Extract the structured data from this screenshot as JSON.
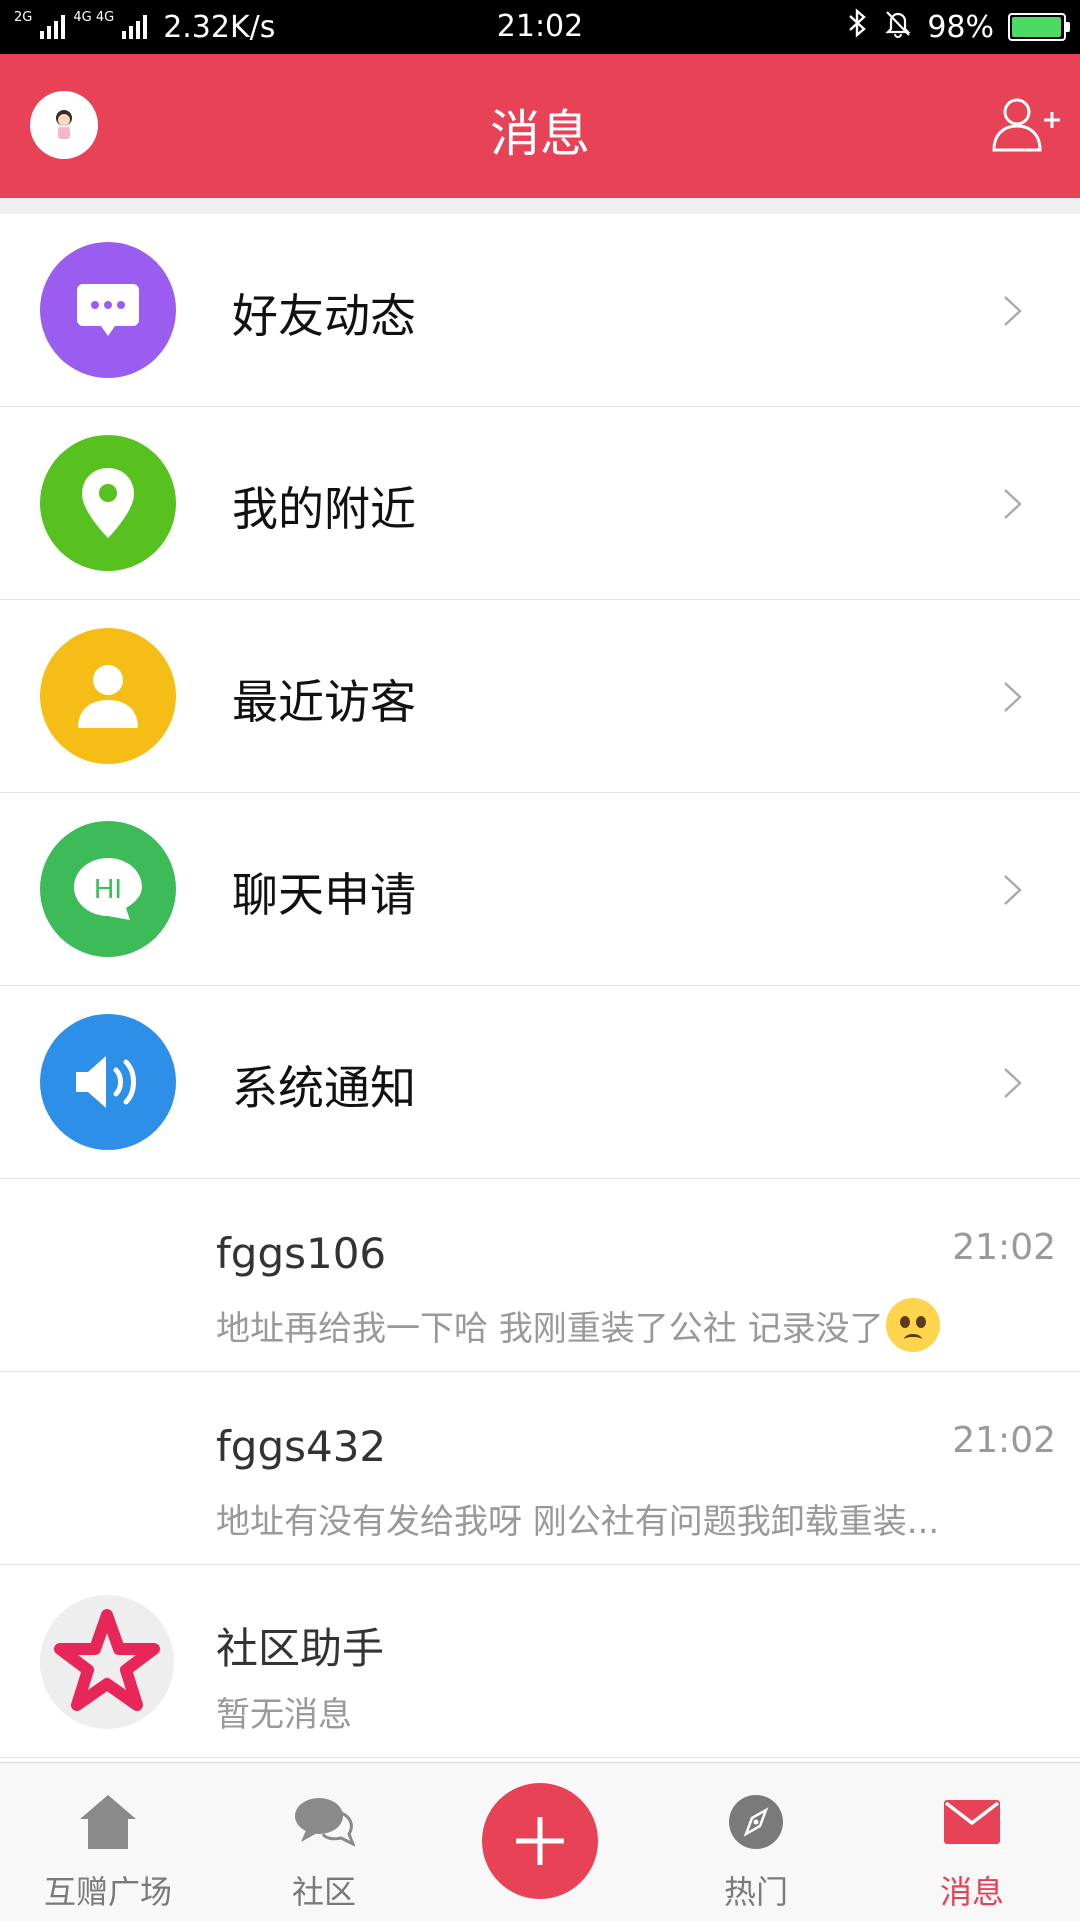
{
  "status_bar": {
    "network_left": "2G",
    "network_right": "4G 4G",
    "speed": "2.32K/s",
    "time": "21:02",
    "battery": "98%",
    "battery_level": 0.98
  },
  "header": {
    "title": "消息"
  },
  "menu_items": [
    {
      "label": "好友动态",
      "icon": "chat-bubble-icon",
      "color": "#9b5cf0"
    },
    {
      "label": "我的附近",
      "icon": "location-pin-icon",
      "color": "#57c21f"
    },
    {
      "label": "最近访客",
      "icon": "person-icon",
      "color": "#f6bd16"
    },
    {
      "label": "聊天申请",
      "icon": "hi-bubble-icon",
      "color": "#3dbb59"
    },
    {
      "label": "系统通知",
      "icon": "speaker-icon",
      "color": "#2e8fe8"
    }
  ],
  "chats": [
    {
      "name": "fggs106",
      "time": "21:02",
      "message": "地址再给我一下哈 我刚重装了公社 记录没了"
    },
    {
      "name": "fggs432",
      "time": "21:02",
      "message": "地址有没有发给我呀 刚公社有问题我卸载重装..."
    },
    {
      "name": "社区助手",
      "time": "",
      "message": "暂无消息"
    }
  ],
  "tabs": [
    {
      "label": "互赠广场",
      "icon": "home-icon"
    },
    {
      "label": "社区",
      "icon": "chat-icon"
    },
    {
      "label": "",
      "icon": "plus-icon"
    },
    {
      "label": "热门",
      "icon": "compass-icon"
    },
    {
      "label": "消息",
      "icon": "mail-icon",
      "active": true
    }
  ],
  "colors": {
    "accent": "#e84256",
    "tab_inactive": "#7a7a7a"
  }
}
